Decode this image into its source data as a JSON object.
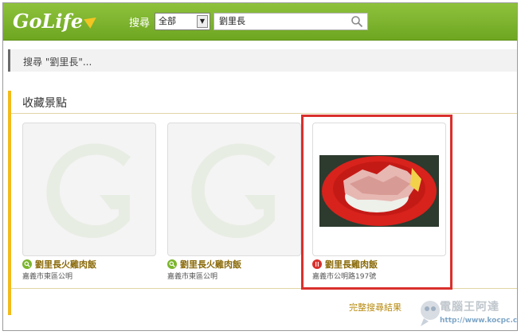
{
  "header": {
    "logo_text": "GoLife",
    "search_label": "搜尋",
    "category_select": "全部",
    "search_query": "劉里長"
  },
  "breadcrumb": "搜尋 \"劉里長\"...",
  "section": {
    "title": "收藏景點",
    "items": [
      {
        "name": "劉里長火雞肉飯",
        "address": "嘉義市東區公明",
        "icon": "search-icon"
      },
      {
        "name": "劉里長火雞肉飯",
        "address": "嘉義市東區公明",
        "icon": "search-icon"
      },
      {
        "name": "劉里長雞肉飯",
        "address": "嘉義市公明路197號",
        "icon": "restaurant-icon"
      }
    ]
  },
  "more_link": "完整搜尋結果",
  "watermark": {
    "text": "電腦王阿達",
    "url": "http://www.kocpc.com.tw"
  },
  "colors": {
    "header_green": "#7bb52c",
    "accent_gold": "#f2bb1a",
    "highlight_red": "#d9302c"
  }
}
